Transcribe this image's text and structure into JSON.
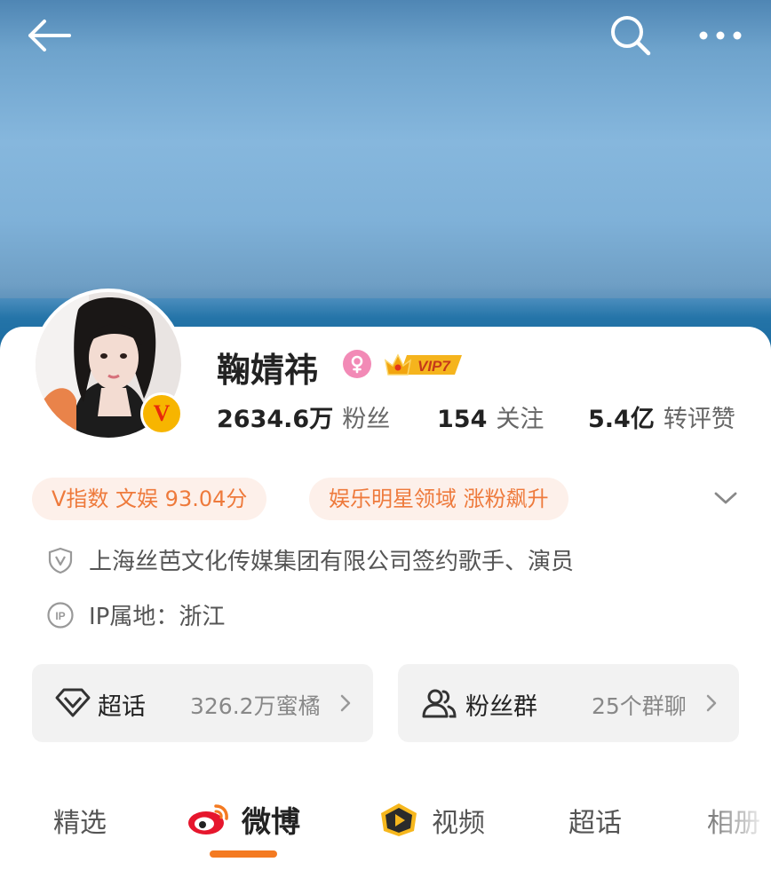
{
  "nav": {
    "back_icon": "arrow-left-icon",
    "search_icon": "search-icon",
    "more_icon": "more-dots-icon"
  },
  "profile": {
    "username": "鞠婧祎",
    "gender_icon": "female-icon",
    "vip_label": "VIP7",
    "verified_badge": "V",
    "stats": [
      {
        "value": "2634.6万",
        "label": "粉丝"
      },
      {
        "value": "154",
        "label": "关注"
      },
      {
        "value": "5.4亿",
        "label": "转评赞"
      }
    ]
  },
  "tags": [
    "V指数 文娱 93.04分",
    "娱乐明星领域 涨粉飙升"
  ],
  "info": {
    "verification": "上海丝芭文化传媒集团有限公司签约歌手、演员",
    "ip_location": "IP属地：浙江"
  },
  "cards": {
    "supertopic": {
      "label": "超话",
      "value": "326.2万蜜橘"
    },
    "fan_group": {
      "label": "粉丝群",
      "value": "25个群聊"
    }
  },
  "tabs": [
    {
      "label": "精选",
      "active": false
    },
    {
      "label": "微博",
      "active": true
    },
    {
      "label": "视频",
      "active": false
    },
    {
      "label": "超话",
      "active": false
    },
    {
      "label": "相册",
      "active": false
    }
  ],
  "colors": {
    "accent": "#f47a21",
    "tag_text": "#ee7a3c",
    "tag_bg": "#fdf0ea",
    "female": "#f28ab6",
    "vip_gold": "#f7b500"
  }
}
